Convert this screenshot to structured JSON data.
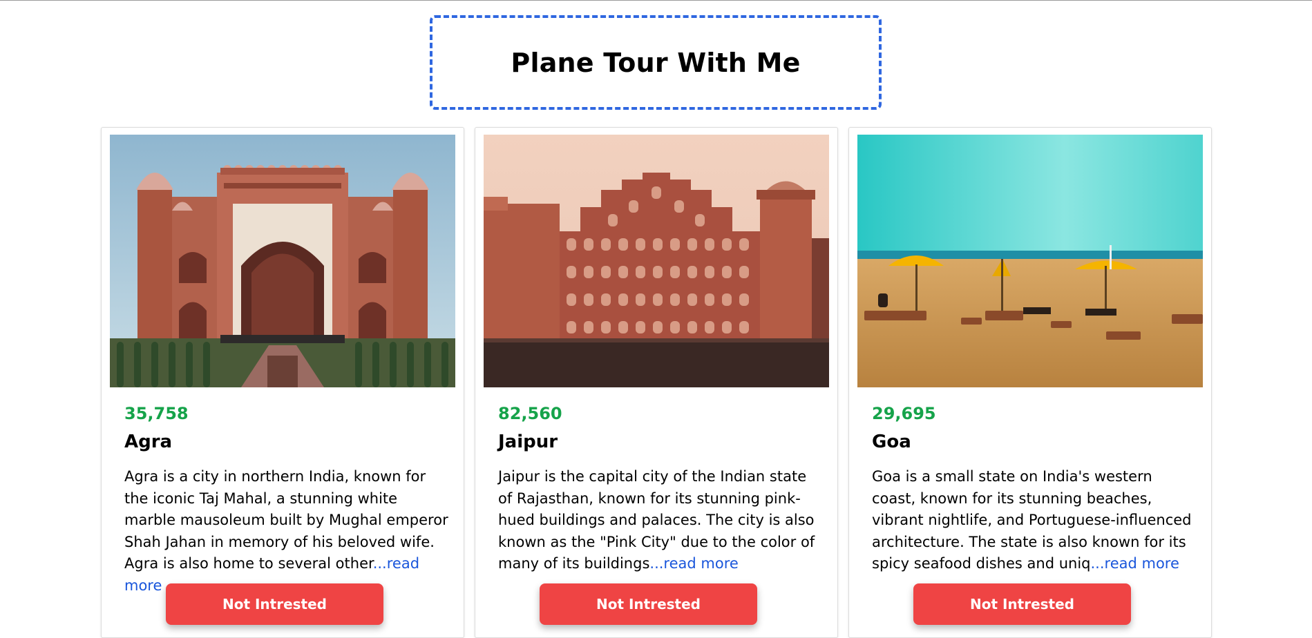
{
  "page": {
    "title": "Plane Tour With Me"
  },
  "colors": {
    "price": "#16a34a",
    "button": "#ef4444",
    "link": "#1a56db",
    "title_border": "#2f67e0"
  },
  "cards": [
    {
      "price": "35,758",
      "city": "Agra",
      "description": "Agra is a city in northern India, known for the iconic Taj Mahal, a stunning white marble mausoleum built by Mughal emperor Shah Jahan in memory of his beloved wife. Agra is also home to several other",
      "read_more": "...read more",
      "button": "Not Intrested",
      "image_subject": "red sandstone Mughal gateway"
    },
    {
      "price": "82,560",
      "city": "Jaipur",
      "description": "Jaipur is the capital city of the Indian state of Rajasthan, known for its stunning pink-hued buildings and palaces. The city is also known as the \"Pink City\" due to the color of many of its buildings",
      "read_more": "...read more",
      "button": "Not Intrested",
      "image_subject": "Hawa Mahal palace facade"
    },
    {
      "price": "29,695",
      "city": "Goa",
      "description": "Goa is a small state on India's western coast, known for its stunning beaches, vibrant nightlife, and Portuguese-influenced architecture. The state is also known for its spicy seafood dishes and uniq",
      "read_more": "...read more",
      "button": "Not Intrested",
      "image_subject": "sandy beach with umbrellas"
    }
  ]
}
